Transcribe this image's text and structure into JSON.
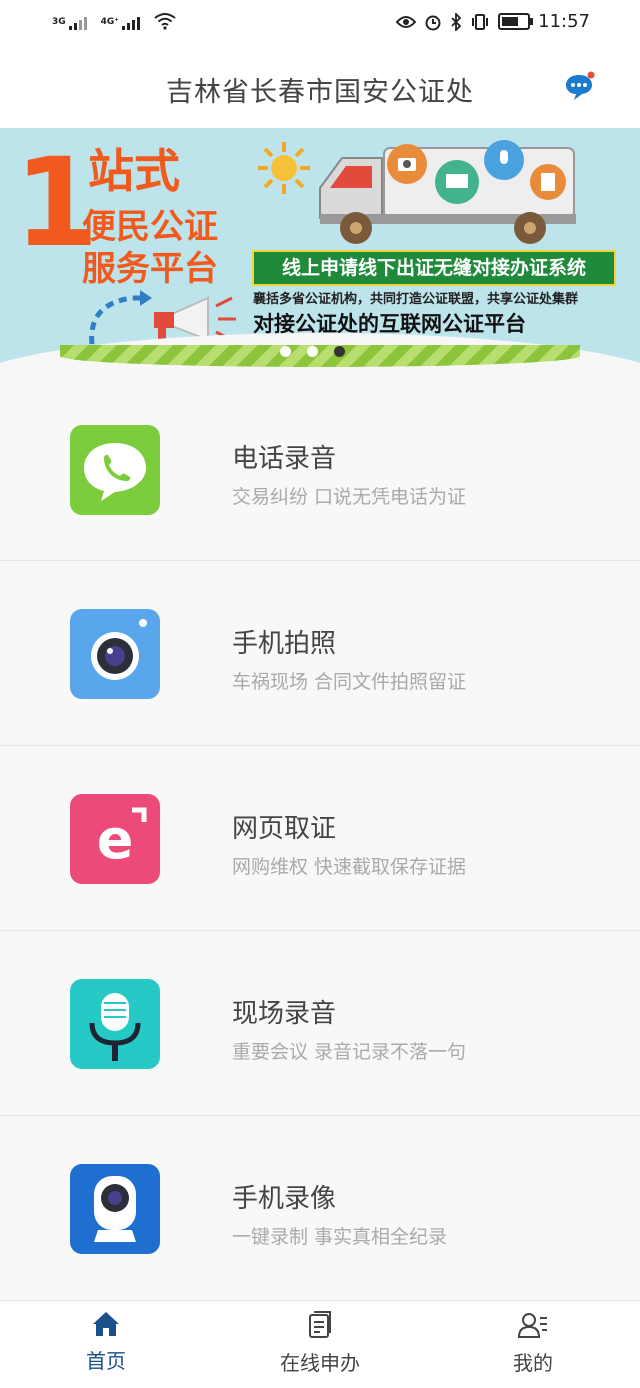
{
  "status_bar": {
    "net1": "3G",
    "net2": "4G⁺",
    "time": "11:57"
  },
  "header": {
    "title": "吉林省长春市国安公证处"
  },
  "banner": {
    "big_number": "1",
    "line1": "站式",
    "line2": "便民公证",
    "line3": "服务平台",
    "green_text": "线上申请线下出证无缝对接办证系统",
    "small_text": "襄括多省公证机构，共同打造公证联盟，共享公证处集群",
    "tagline": "对接公证处的互联网公证平台",
    "page_count": 3,
    "active_page": 3
  },
  "features": [
    {
      "title": "电话录音",
      "desc": "交易纠纷 口说无凭电话为证",
      "icon": "phone-bubble-icon",
      "color": "#7ccd3e"
    },
    {
      "title": "手机拍照",
      "desc": "车祸现场 合同文件拍照留证",
      "icon": "camera-icon",
      "color": "#5aa6ec"
    },
    {
      "title": "网页取证",
      "desc": "网购维权 快速截取保存证据",
      "icon": "e-browser-icon",
      "color": "#ec4b7a"
    },
    {
      "title": "现场录音",
      "desc": "重要会议 录音记录不落一句",
      "icon": "microphone-icon",
      "color": "#27c9c6"
    },
    {
      "title": "手机录像",
      "desc": "一键录制 事实真相全纪录",
      "icon": "webcam-icon",
      "color": "#1f6fd0"
    }
  ],
  "nav": [
    {
      "label": "首页",
      "icon": "home-icon",
      "active": true
    },
    {
      "label": "在线申办",
      "icon": "document-icon",
      "active": false
    },
    {
      "label": "我的",
      "icon": "profile-icon",
      "active": false
    }
  ]
}
